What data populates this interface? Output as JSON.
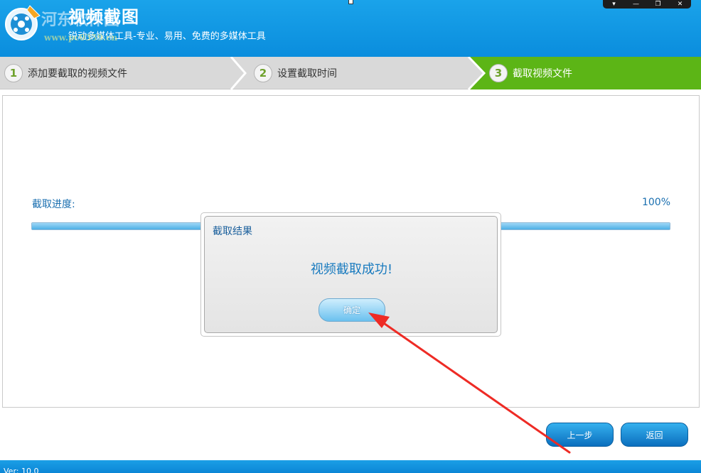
{
  "app": {
    "title": "视频截图",
    "subtitle": "锐动多媒体工具-专业、易用、免费的多媒体工具",
    "watermark": "河东软件园",
    "watermark_url": "www.pc0359.cn",
    "version": "Ver: 10.0"
  },
  "window_controls": [
    "▾",
    "—",
    "❐",
    "✕"
  ],
  "steps": [
    {
      "num": "1",
      "label": "添加要截取的视频文件"
    },
    {
      "num": "2",
      "label": "设置截取时间"
    },
    {
      "num": "3",
      "label": "截取视频文件"
    }
  ],
  "progress": {
    "label": "截取进度:",
    "percent_text": "100%",
    "value": 100
  },
  "dialog": {
    "title": "截取结果",
    "message": "视频截取成功!",
    "ok_label": "确定"
  },
  "buttons": {
    "prev_label": "上一步",
    "back_label": "返回"
  },
  "colors": {
    "header_blue": "#0a8ddd",
    "active_step_green": "#5cb516",
    "annotation_arrow": "#ee2b25"
  },
  "icons": {
    "logo": "film-scissors-logo-icon",
    "annotation": "red-arrow-annotation"
  }
}
